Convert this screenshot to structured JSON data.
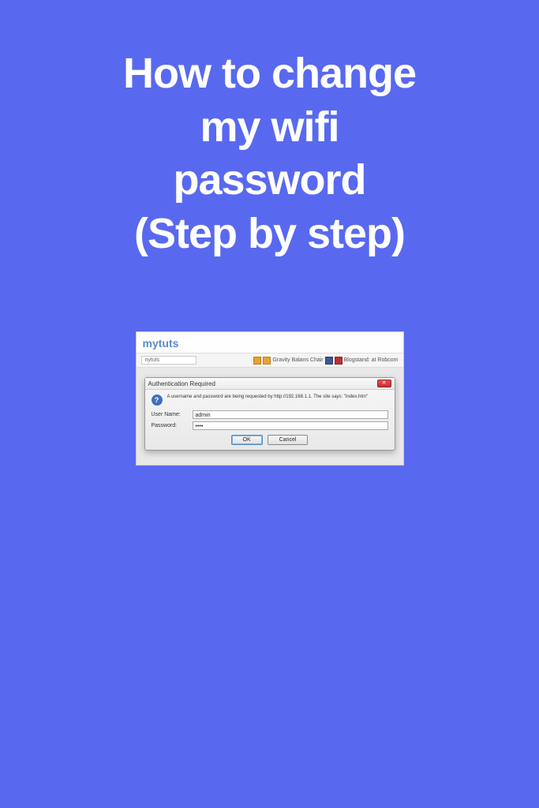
{
  "title_line1": "How to change",
  "title_line2": "my wifi",
  "title_line3": "password",
  "title_line4": "(Step by step)",
  "browser": {
    "site_name": "mytuts",
    "url_text": "nytuts",
    "toolbar_text1": "Gravity Balans Chair",
    "toolbar_text2": "Blogstand: at Robcom"
  },
  "dialog": {
    "title": "Authentication Required",
    "close_glyph": "✕",
    "info_glyph": "?",
    "message": "A username and password are being requested by http://192.168.1.1. The site says: \"index.htm\"",
    "username_label": "User Name:",
    "username_value": "admin",
    "password_label": "Password:",
    "password_value": "••••",
    "ok_label": "OK",
    "cancel_label": "Cancel"
  }
}
